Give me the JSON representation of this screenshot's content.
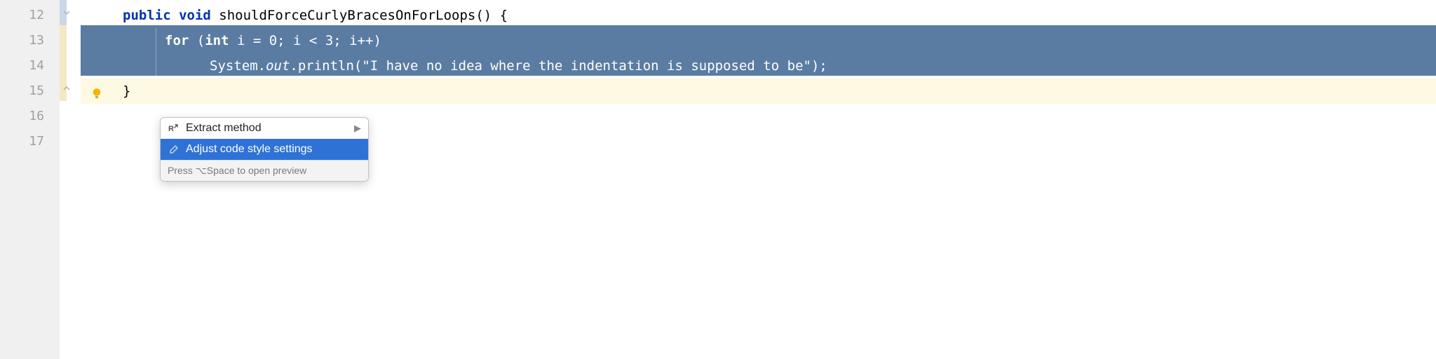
{
  "gutter": {
    "start": 12,
    "lines": [
      "12",
      "13",
      "14",
      "15",
      "16",
      "17"
    ]
  },
  "code": {
    "line12_kw1": "public",
    "line12_kw2": "void",
    "line12_ident": " shouldForceCurlyBracesOnForLoops() {",
    "line13_kw1": "for",
    "line13_rest1": " (",
    "line13_kw2": "int",
    "line13_rest2": " i = 0; i < 3; i++)",
    "line14_a": "System.",
    "line14_out": "out",
    "line14_b": ".println(",
    "line14_str": "\"I have no idea where the indentation is supposed to be\"",
    "line14_c": ");",
    "line15": "}"
  },
  "popup": {
    "item1": "Extract method",
    "item2": "Adjust code style settings",
    "footer": "Press ⌥Space to open preview"
  },
  "icons": {
    "extract": "R↗",
    "edit": "✎"
  }
}
